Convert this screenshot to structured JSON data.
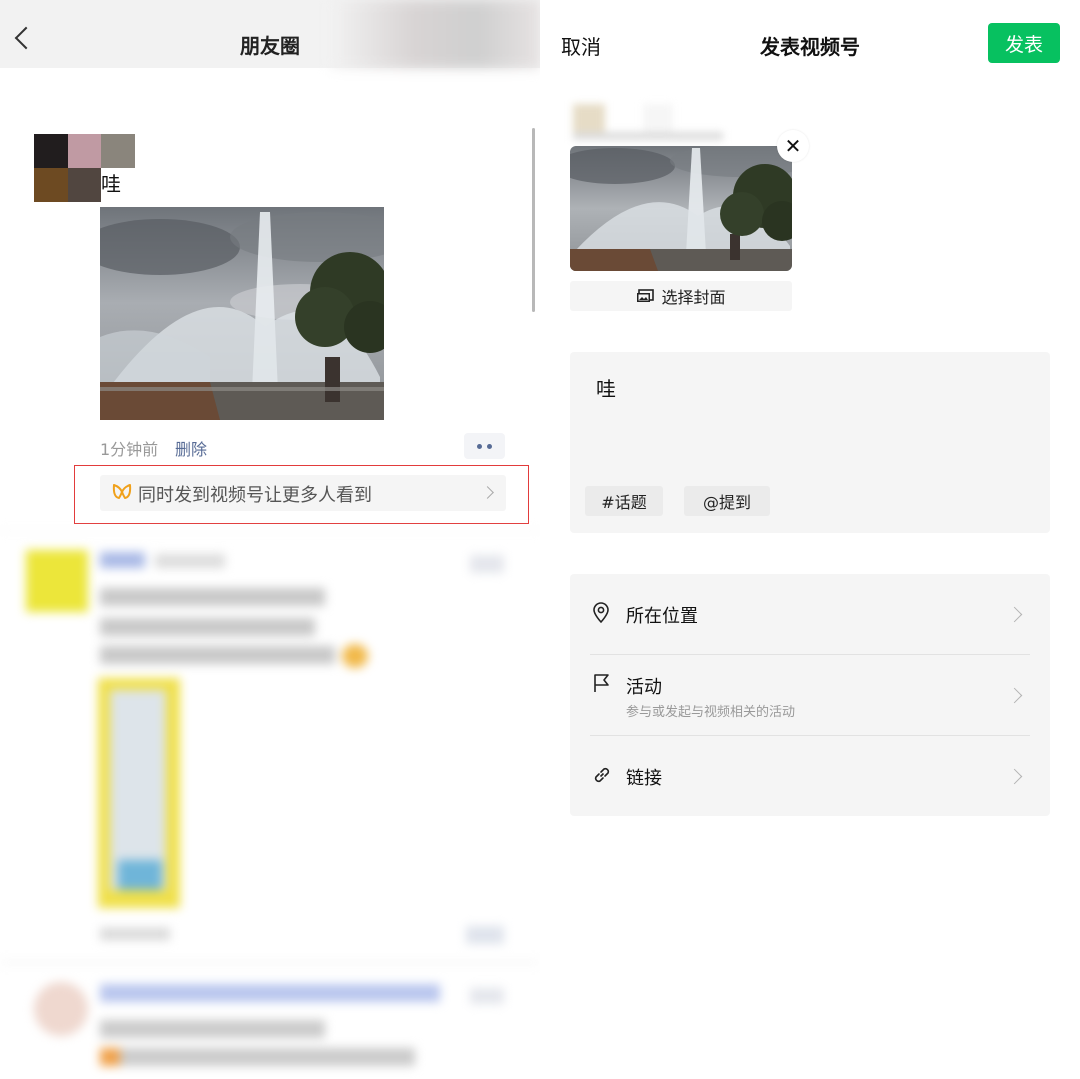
{
  "left": {
    "title": "朋友圈",
    "post": {
      "text": "哇",
      "time": "1分钟前",
      "delete_label": "删除",
      "promo_text": "同时发到视频号让更多人看到"
    }
  },
  "right": {
    "cancel_label": "取消",
    "title": "发表视频号",
    "publish_label": "发表",
    "cover_label": "选择封面",
    "caption": "哇",
    "tags": {
      "topic": "#话题",
      "mention": "@提到"
    },
    "options": [
      {
        "label": "所在位置",
        "icon": "location-pin-icon"
      },
      {
        "label": "活动",
        "sublabel": "参与或发起与视频相关的活动",
        "icon": "flag-icon"
      },
      {
        "label": "链接",
        "icon": "link-icon"
      }
    ]
  },
  "colors": {
    "brand_green": "#07c160",
    "link_blue": "#576b95",
    "highlight_red": "#e23b3b"
  }
}
